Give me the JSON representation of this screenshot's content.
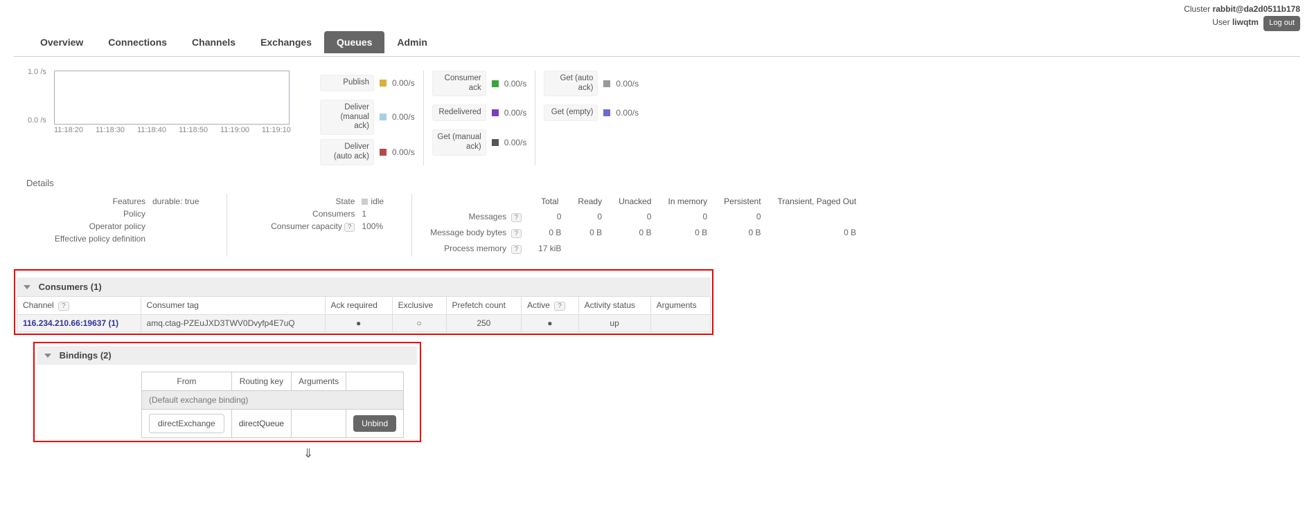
{
  "header": {
    "cluster_label": "Cluster",
    "cluster_name": "rabbit@da2d0511b178",
    "user_label": "User",
    "user_name": "liwqtm",
    "logout": "Log out"
  },
  "tabs": [
    "Overview",
    "Connections",
    "Channels",
    "Exchanges",
    "Queues",
    "Admin"
  ],
  "tabs_active_index": 4,
  "chart": {
    "y_top": "1.0 /s",
    "y_bottom": "0.0 /s",
    "x_ticks": [
      "11:18:20",
      "11:18:30",
      "11:18:40",
      "11:18:50",
      "11:19:00",
      "11:19:10"
    ]
  },
  "rates": [
    [
      {
        "label": "Publish",
        "color": "#d9b13b",
        "value": "0.00/s"
      },
      {
        "label": "Deliver (manual ack)",
        "color": "#a7d0e4",
        "value": "0.00/s"
      },
      {
        "label": "Deliver (auto ack)",
        "color": "#b34a4a",
        "value": "0.00/s"
      }
    ],
    [
      {
        "label": "Consumer ack",
        "color": "#3aa53a",
        "value": "0.00/s"
      },
      {
        "label": "Redelivered",
        "color": "#7a3fbf",
        "value": "0.00/s"
      },
      {
        "label": "Get (manual ack)",
        "color": "#555555",
        "value": "0.00/s"
      }
    ],
    [
      {
        "label": "Get (auto ack)",
        "color": "#999999",
        "value": "0.00/s"
      },
      {
        "label": "Get (empty)",
        "color": "#6b6bd1",
        "value": "0.00/s"
      }
    ]
  ],
  "details_title": "Details",
  "details_left": {
    "features_label": "Features",
    "features_value": "durable:",
    "features_true": "true",
    "policy_label": "Policy",
    "op_policy_label": "Operator policy",
    "eff_policy_label": "Effective policy definition"
  },
  "details_mid": {
    "state_label": "State",
    "state_value": "idle",
    "consumers_label": "Consumers",
    "consumers_value": "1",
    "capacity_label": "Consumer capacity",
    "capacity_value": "100%"
  },
  "msg_table": {
    "cols": [
      "Total",
      "Ready",
      "Unacked",
      "In memory",
      "Persistent",
      "Transient, Paged Out"
    ],
    "rows": [
      {
        "label": "Messages",
        "help": true,
        "cells": [
          "0",
          "0",
          "0",
          "0",
          "0",
          ""
        ]
      },
      {
        "label": "Message body bytes",
        "help": true,
        "cells": [
          "0 B",
          "0 B",
          "0 B",
          "0 B",
          "0 B",
          "0 B"
        ]
      },
      {
        "label": "Process memory",
        "help": true,
        "cells": [
          "17 kiB",
          "",
          "",
          "",
          "",
          ""
        ]
      }
    ]
  },
  "consumers": {
    "title": "Consumers (1)",
    "headers": [
      "Channel",
      "Consumer tag",
      "Ack required",
      "Exclusive",
      "Prefetch count",
      "Active",
      "Activity status",
      "Arguments"
    ],
    "header_help": {
      "0": true,
      "5": true
    },
    "row": {
      "channel": "116.234.210.66:19637 (1)",
      "tag": "amq.ctag-PZEuJXD3TWV0Dvyfp4E7uQ",
      "ack": "●",
      "exclusive": "○",
      "prefetch": "250",
      "active": "●",
      "status": "up",
      "args": ""
    }
  },
  "bindings": {
    "title": "Bindings (2)",
    "headers": [
      "From",
      "Routing key",
      "Arguments",
      ""
    ],
    "default_row": "(Default exchange binding)",
    "row": {
      "from": "directExchange",
      "routing_key": "directQueue",
      "args": "",
      "unbind": "Unbind"
    },
    "arrow": "⇓"
  },
  "help_glyph": "?"
}
